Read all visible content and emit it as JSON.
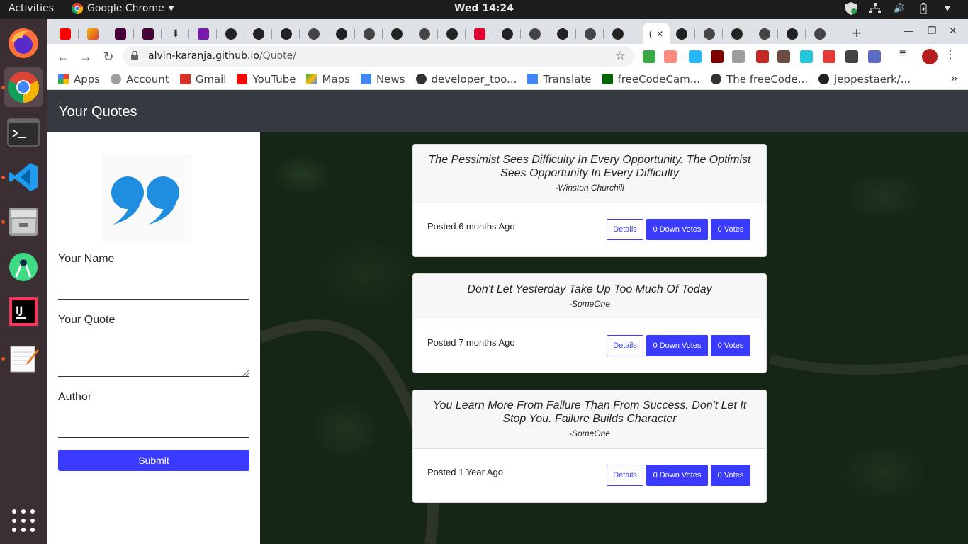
{
  "system": {
    "activities": "Activities",
    "app_name": "Google Chrome",
    "clock": "Wed 14:24"
  },
  "browser": {
    "active_tab_title": "(",
    "url_host": "alvin-karanja.github.io",
    "url_path": "/Quote/",
    "bookmarks": [
      {
        "label": "Apps",
        "icon": "apps-grid-icon",
        "color": "#4285f4"
      },
      {
        "label": "Account",
        "icon": "account-icon",
        "color": "#777777"
      },
      {
        "label": "Gmail",
        "icon": "gmail-icon",
        "color": "#d93025"
      },
      {
        "label": "YouTube",
        "icon": "youtube-icon",
        "color": "#ff0000"
      },
      {
        "label": "Maps",
        "icon": "maps-icon",
        "color": "#34a853"
      },
      {
        "label": "News",
        "icon": "news-icon",
        "color": "#4285f4"
      },
      {
        "label": "developer_too...",
        "icon": "globe-icon",
        "color": "#333333"
      },
      {
        "label": "Translate",
        "icon": "translate-icon",
        "color": "#4285f4"
      },
      {
        "label": "freeCodeCam...",
        "icon": "freecodecamp-icon",
        "color": "#006400"
      },
      {
        "label": "The freeCode...",
        "icon": "globe-icon",
        "color": "#333333"
      },
      {
        "label": "jeppestaerk/...",
        "icon": "github-icon",
        "color": "#222222"
      }
    ]
  },
  "site": {
    "brand": "Your Quotes",
    "accent_color": "#3b3bff",
    "form": {
      "name_label": "Your Name",
      "quote_label": "Your Quote",
      "author_label": "Author",
      "submit_label": "Submit"
    },
    "quotes": [
      {
        "text": "The Pessimist Sees Difficulty In Every Opportunity. The Optimist Sees Opportunity In Every Difficulty",
        "author": "-Winston Churchill",
        "posted": "Posted 6 months Ago",
        "details_label": "Details",
        "down_votes_label": "0 Down Votes",
        "votes_label": "0 Votes"
      },
      {
        "text": "Don't Let Yesterday Take Up Too Much Of Today",
        "author": "-SomeOne",
        "posted": "Posted 7 months Ago",
        "details_label": "Details",
        "down_votes_label": "0 Down Votes",
        "votes_label": "0 Votes"
      },
      {
        "text": "You Learn More From Failure Than From Success. Don't Let It Stop You. Failure Builds Character",
        "author": "-SomeOne",
        "posted": "Posted 1 Year Ago",
        "details_label": "Details",
        "down_votes_label": "0 Down Votes",
        "votes_label": "0 Votes"
      }
    ]
  }
}
